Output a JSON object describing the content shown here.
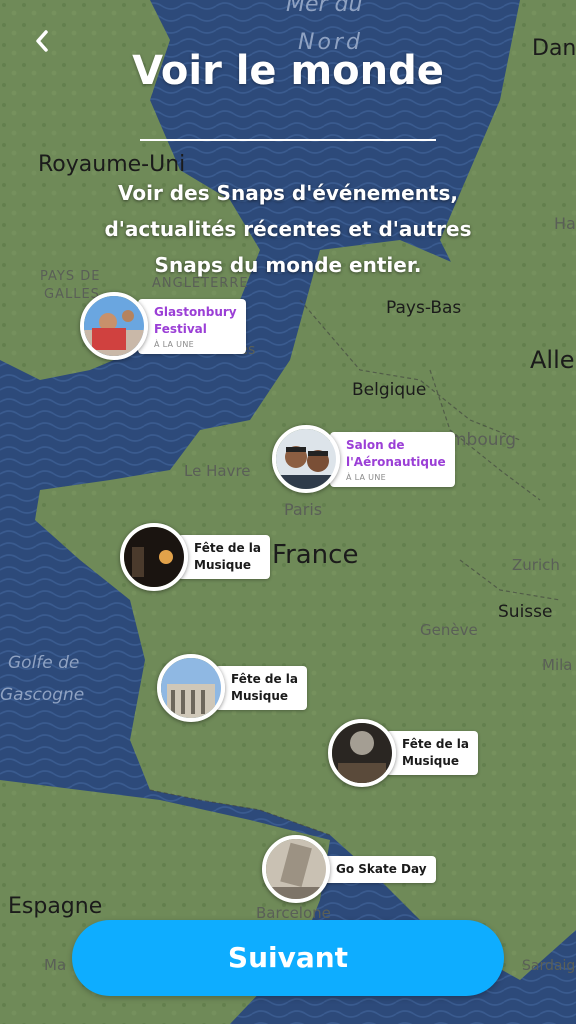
{
  "header": {
    "back_icon": "chevron-left-icon",
    "title": "Voir le monde",
    "subtitle": "Voir des Snaps d'événements, d'actualités récentes et d'autres Snaps du monde entier."
  },
  "map_labels": {
    "mer_du": "Mer du",
    "nord": "Nord",
    "dan": "Dan",
    "royaume_uni": "Royaume-Uni",
    "ha": "Ha",
    "pays_de": "PAYS DE",
    "galles": "GALLES",
    "angleterre": "ANGLETERRE",
    "pays_bas": "Pays-Bas",
    "londres": "Londres",
    "alle": "Alle",
    "belgique": "Belgique",
    "xembourg": "xembourg",
    "le_havre": "Le Havre",
    "paris": "Paris",
    "france": "France",
    "zurich": "Zurich",
    "suisse": "Suisse",
    "geneve": "Genève",
    "golfe_de": "Golfe de",
    "gascogne": "Gascogne",
    "mila": "Mila",
    "espagne": "Espagne",
    "barcelone": "Barcelone",
    "sardaig": "Sardaig",
    "ma": "Ma"
  },
  "pins": [
    {
      "title": "Glastonbury Festival",
      "line1": "Glastonbury",
      "line2": "Festival",
      "badge": "À LA UNE",
      "featured": true
    },
    {
      "title": "Salon de l'Aéronautique",
      "line1": "Salon de",
      "line2": "l'Aéronautique",
      "badge": "À LA UNE",
      "featured": true
    },
    {
      "title": "Fête de la Musique",
      "line1": "Fête de la",
      "line2": "Musique"
    },
    {
      "title": "Fête de la Musique",
      "line1": "Fête de la",
      "line2": "Musique"
    },
    {
      "title": "Fête de la Musique",
      "line1": "Fête de la",
      "line2": "Musique"
    },
    {
      "title": "Go Skate Day",
      "line1": "Go Skate Day"
    }
  ],
  "footer": {
    "next_label": "Suivant"
  },
  "colors": {
    "sea": "#2d4a7a",
    "land": "#6f8a58",
    "accent_button": "#0eadff",
    "featured_text": "#9b3fd6"
  }
}
